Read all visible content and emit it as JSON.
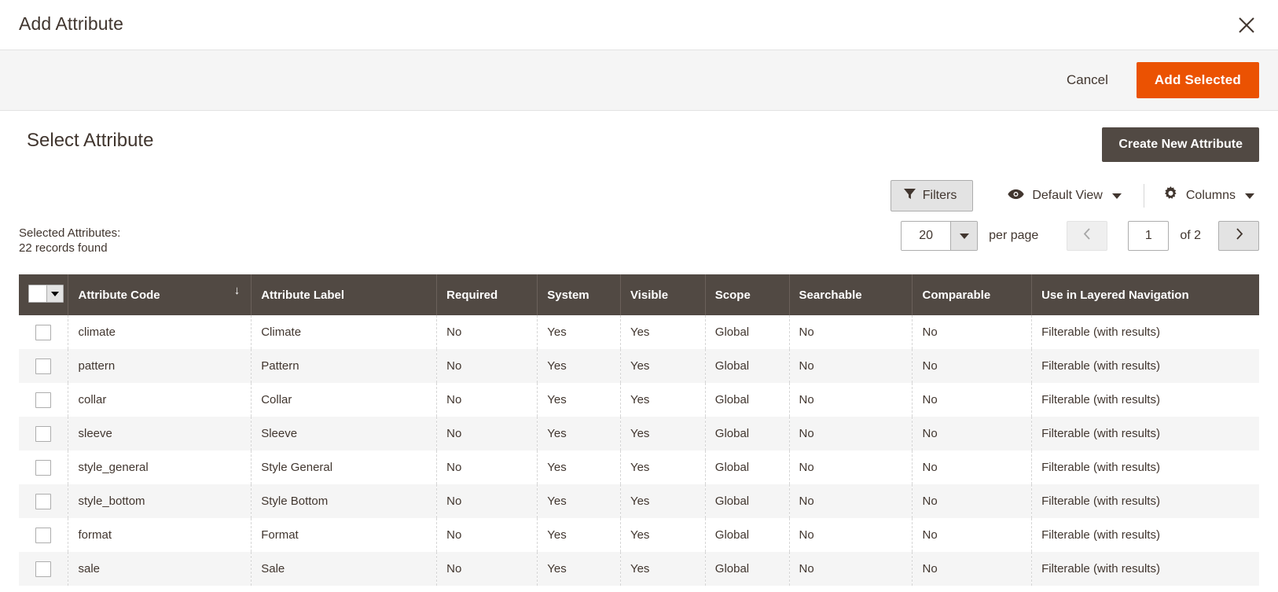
{
  "modal": {
    "title": "Add Attribute",
    "close_icon": "close-icon"
  },
  "action_bar": {
    "cancel_label": "Cancel",
    "add_selected_label": "Add Selected",
    "primary_color": "#eb5202"
  },
  "section": {
    "title": "Select Attribute",
    "create_new_label": "Create New Attribute",
    "secondary_color": "#514943"
  },
  "toolbar": {
    "filters_label": "Filters",
    "filters_icon": "funnel-icon",
    "view_label": "Default View",
    "view_icon": "eye-icon",
    "columns_label": "Columns",
    "columns_icon": "gear-icon"
  },
  "grid_info": {
    "selected_label": "Selected Attributes:",
    "records_found": "22 records found"
  },
  "pager": {
    "limit_value": "20",
    "per_page_label": "per page",
    "prev_icon": "chevron-left-icon",
    "next_icon": "chevron-right-icon",
    "current_page": "1",
    "of_label": "of 2"
  },
  "table": {
    "columns": [
      "Attribute Code",
      "Attribute Label",
      "Required",
      "System",
      "Visible",
      "Scope",
      "Searchable",
      "Comparable",
      "Use in Layered Navigation"
    ],
    "sort_column": "Attribute Code",
    "sort_indicator": "↓",
    "rows": [
      {
        "attribute_code": "climate",
        "attribute_label": "Climate",
        "required": "No",
        "system": "Yes",
        "visible": "Yes",
        "scope": "Global",
        "searchable": "No",
        "comparable": "No",
        "layered_navigation": "Filterable (with results)"
      },
      {
        "attribute_code": "pattern",
        "attribute_label": "Pattern",
        "required": "No",
        "system": "Yes",
        "visible": "Yes",
        "scope": "Global",
        "searchable": "No",
        "comparable": "No",
        "layered_navigation": "Filterable (with results)"
      },
      {
        "attribute_code": "collar",
        "attribute_label": "Collar",
        "required": "No",
        "system": "Yes",
        "visible": "Yes",
        "scope": "Global",
        "searchable": "No",
        "comparable": "No",
        "layered_navigation": "Filterable (with results)"
      },
      {
        "attribute_code": "sleeve",
        "attribute_label": "Sleeve",
        "required": "No",
        "system": "Yes",
        "visible": "Yes",
        "scope": "Global",
        "searchable": "No",
        "comparable": "No",
        "layered_navigation": "Filterable (with results)"
      },
      {
        "attribute_code": "style_general",
        "attribute_label": "Style General",
        "required": "No",
        "system": "Yes",
        "visible": "Yes",
        "scope": "Global",
        "searchable": "No",
        "comparable": "No",
        "layered_navigation": "Filterable (with results)"
      },
      {
        "attribute_code": "style_bottom",
        "attribute_label": "Style Bottom",
        "required": "No",
        "system": "Yes",
        "visible": "Yes",
        "scope": "Global",
        "searchable": "No",
        "comparable": "No",
        "layered_navigation": "Filterable (with results)"
      },
      {
        "attribute_code": "format",
        "attribute_label": "Format",
        "required": "No",
        "system": "Yes",
        "visible": "Yes",
        "scope": "Global",
        "searchable": "No",
        "comparable": "No",
        "layered_navigation": "Filterable (with results)"
      },
      {
        "attribute_code": "sale",
        "attribute_label": "Sale",
        "required": "No",
        "system": "Yes",
        "visible": "Yes",
        "scope": "Global",
        "searchable": "No",
        "comparable": "No",
        "layered_navigation": "Filterable (with results)"
      }
    ]
  }
}
